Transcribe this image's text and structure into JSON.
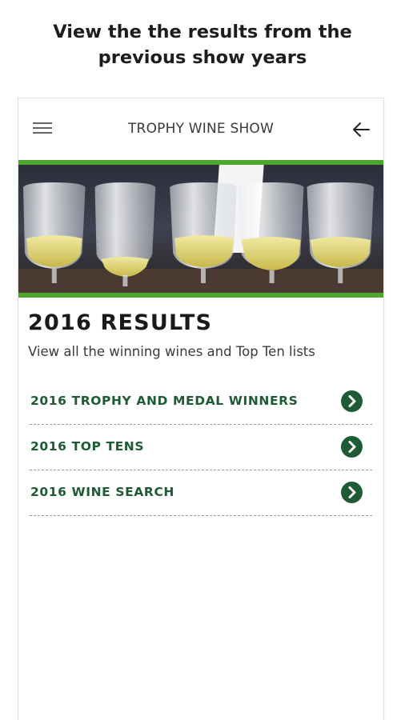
{
  "promo": {
    "caption_line1": "View the the results from the",
    "caption_line2": "previous show years"
  },
  "app_bar": {
    "title": "TROPHY WINE SHOW",
    "menu_icon": "hamburger-menu-icon",
    "back_icon": "arrow-left-icon"
  },
  "hero": {
    "image": "row of white wine glasses on a table"
  },
  "results": {
    "title": "2016 RESULTS",
    "subtitle": "View all the winning wines and Top Ten lists",
    "links": [
      {
        "label": "2016 TROPHY AND MEDAL WINNERS",
        "icon": "chevron-right-circle-icon"
      },
      {
        "label": "2016 TOP TENS",
        "icon": "chevron-right-circle-icon"
      },
      {
        "label": "2016 WINE SEARCH",
        "icon": "chevron-right-circle-icon"
      }
    ]
  },
  "colors": {
    "accent_green": "#4ea62f",
    "link_green": "#1e5a33",
    "divider": "#9a9a9a"
  }
}
